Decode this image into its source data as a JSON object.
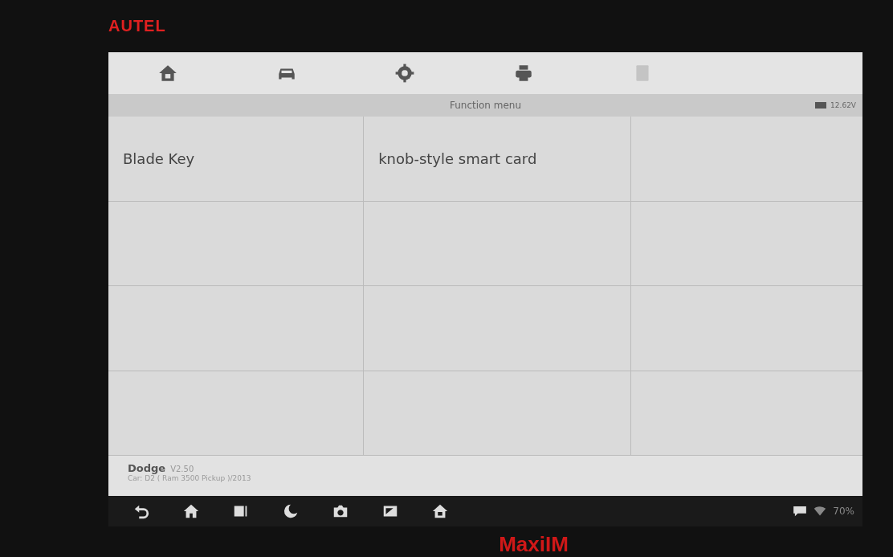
{
  "device": {
    "brand": "AUTEL",
    "model": "MaxiIM"
  },
  "toolbar": [
    {
      "kind": "home",
      "disabled": false
    },
    {
      "kind": "car",
      "disabled": false
    },
    {
      "kind": "settings",
      "disabled": false
    },
    {
      "kind": "print",
      "disabled": false
    },
    {
      "kind": "help",
      "disabled": true
    }
  ],
  "title_bar": {
    "title": "Function menu",
    "voltage": "12.62V"
  },
  "menu": [
    {
      "label": "Blade Key"
    },
    {
      "label": "knob-style smart card"
    }
  ],
  "footer": {
    "make": "Dodge",
    "version": "V2.50",
    "vehicle": "Car: D2 ( Ram 3500 Pickup )/2013"
  },
  "nav_bar": {
    "buttons": [
      {
        "kind": "back"
      },
      {
        "kind": "home"
      },
      {
        "kind": "recent"
      },
      {
        "kind": "browser"
      },
      {
        "kind": "camera"
      },
      {
        "kind": "screen"
      },
      {
        "kind": "home-alt"
      }
    ],
    "battery": "70%"
  }
}
